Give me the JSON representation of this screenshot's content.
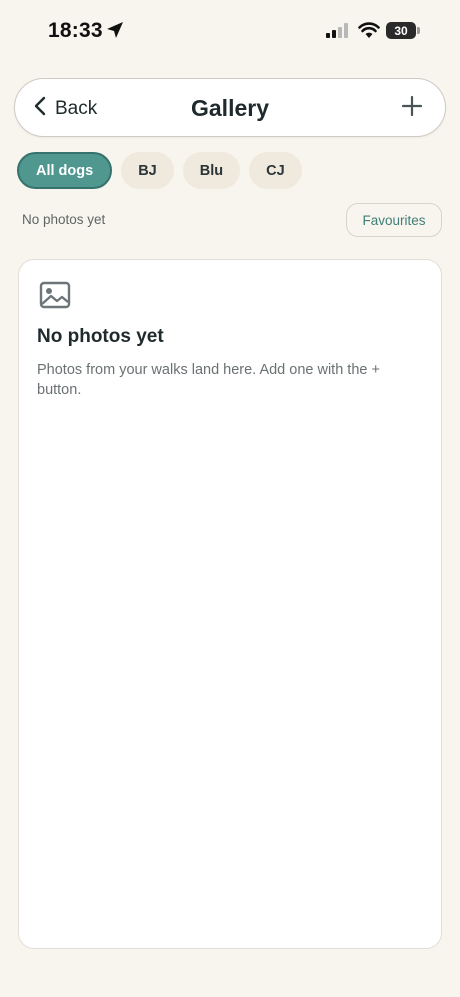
{
  "status_bar": {
    "time": "18:33",
    "battery": "30",
    "icons": [
      "location-arrow-icon",
      "cellular-signal-icon",
      "wifi-icon",
      "battery-icon"
    ]
  },
  "header": {
    "back_label": "Back",
    "title": "Gallery",
    "add_icon": "plus-icon"
  },
  "filters": {
    "chips": [
      {
        "label": "All dogs",
        "active": true
      },
      {
        "label": "BJ",
        "active": false
      },
      {
        "label": "Blu",
        "active": false
      },
      {
        "label": "CJ",
        "active": false
      }
    ]
  },
  "subbar": {
    "status_text": "No photos yet",
    "favourites_label": "Favourites"
  },
  "empty_state": {
    "icon": "image-icon",
    "title": "No photos yet",
    "body": "Photos from your walks land here. Add one with the + button."
  },
  "colors": {
    "background": "#f8f4ee",
    "accent": "#4f978f",
    "accent_text": "#3f7f77",
    "chip_bg": "#efe9de"
  }
}
